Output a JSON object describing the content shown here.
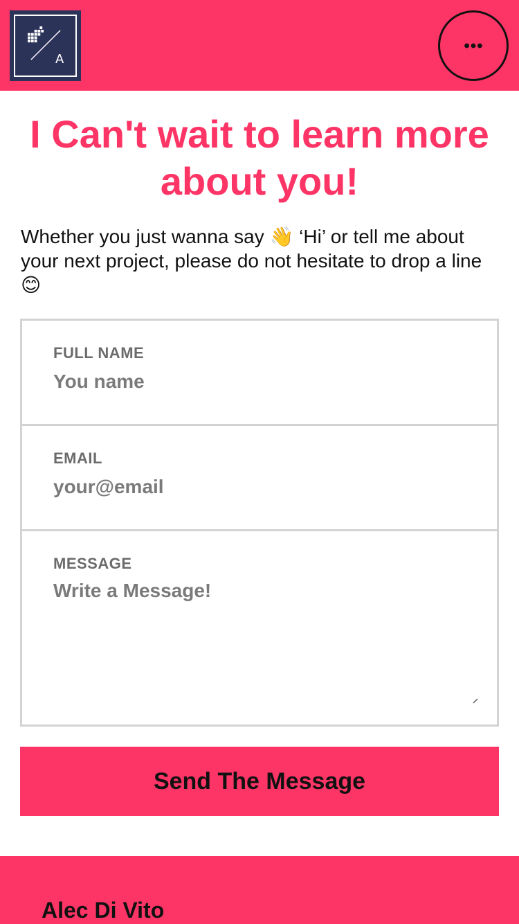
{
  "header": {
    "logo_letter": "A",
    "menu_icon": "more-horizontal-icon",
    "background_color": "#fc3566"
  },
  "main": {
    "headline": "I Can't wait to learn more about you!",
    "intro": "Whether you just wanna say 👋 ‘Hi’ or tell me about your next project, please do not hesitate to drop a line 😊"
  },
  "form": {
    "full_name": {
      "label": "FULL NAME",
      "placeholder": "You name",
      "value": ""
    },
    "email": {
      "label": "EMAIL",
      "placeholder": "your@email",
      "value": ""
    },
    "message": {
      "label": "MESSAGE",
      "placeholder": "Write a Message!",
      "value": ""
    },
    "submit_label": "Send The Message"
  },
  "footer": {
    "name": "Alec Di Vito"
  },
  "colors": {
    "accent": "#fc3566",
    "logo_navy": "#2c3359",
    "border_gray": "#d3d3d3"
  }
}
